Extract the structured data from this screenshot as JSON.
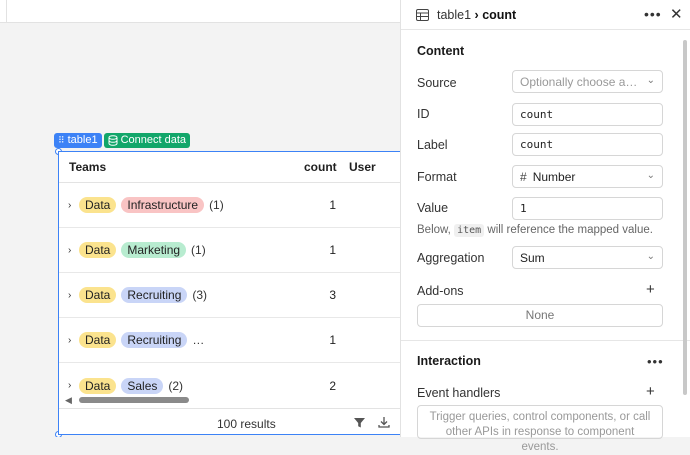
{
  "component_tags": {
    "name": "table1",
    "connect": "Connect data"
  },
  "table": {
    "columns": [
      "Teams",
      "count",
      "User"
    ],
    "rows": [
      {
        "pills": [
          {
            "text": "Data",
            "color": "#fbe38e"
          },
          {
            "text": "Infrastructure",
            "color": "#f9c4c4"
          }
        ],
        "extra": "(1)",
        "count": "1"
      },
      {
        "pills": [
          {
            "text": "Data",
            "color": "#fbe38e"
          },
          {
            "text": "Marketing",
            "color": "#b8ecd0"
          }
        ],
        "extra": "(1)",
        "count": "1"
      },
      {
        "pills": [
          {
            "text": "Data",
            "color": "#fbe38e"
          },
          {
            "text": "Recruiting",
            "color": "#c9d5f7"
          }
        ],
        "extra": "(3)",
        "count": "3"
      },
      {
        "pills": [
          {
            "text": "Data",
            "color": "#fbe38e"
          },
          {
            "text": "Recruiting",
            "color": "#c9d5f7"
          }
        ],
        "extra": "…",
        "count": "1"
      },
      {
        "pills": [
          {
            "text": "Data",
            "color": "#fbe38e"
          },
          {
            "text": "Sales",
            "color": "#c9d5f7"
          }
        ],
        "extra": "(2)",
        "count": "2"
      }
    ],
    "footer": {
      "results": "100 results"
    }
  },
  "inspector": {
    "breadcrumb_parent": "table1",
    "breadcrumb_sep": "›",
    "breadcrumb_current": "count",
    "content_title": "Content",
    "source_label": "Source",
    "source_placeholder": "Optionally choose a…",
    "id_label": "ID",
    "id_value": "count",
    "label_label": "Label",
    "label_value": "count",
    "format_label": "Format",
    "format_value": "Number",
    "value_label": "Value",
    "value_value": "1",
    "hint_before": "Below,",
    "hint_code": "item",
    "hint_after": "will reference the mapped value.",
    "aggregation_label": "Aggregation",
    "aggregation_value": "Sum",
    "addons_label": "Add-ons",
    "addons_none": "None",
    "interaction_title": "Interaction",
    "event_handlers_label": "Event handlers",
    "event_placeholder": "Trigger queries, control components, or call other APIs in response to component events."
  }
}
